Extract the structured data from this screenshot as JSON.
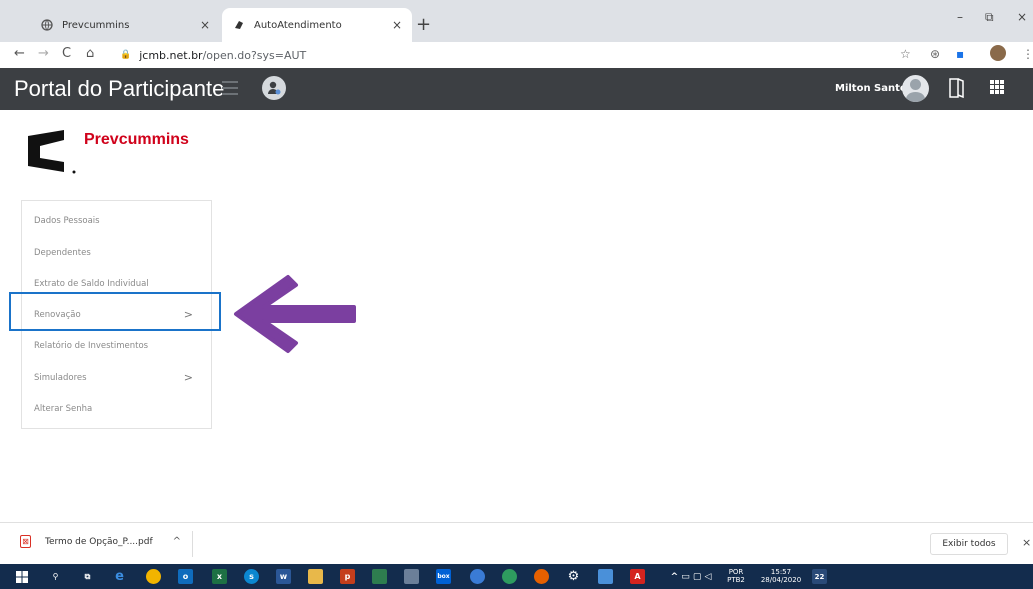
{
  "browser": {
    "tabs": [
      {
        "label": "Prevcummins",
        "close": "×"
      },
      {
        "label": "AutoAtendimento",
        "close": "×"
      }
    ],
    "new_tab": "+",
    "window_controls": {
      "minimize": "–",
      "restore": "⧉",
      "close": "×"
    },
    "nav": {
      "back": "←",
      "forward": "→",
      "reload": "C",
      "home": "⌂"
    },
    "url": {
      "host": "jcmb.net.br",
      "path": "/open.do?sys=AUT"
    }
  },
  "header": {
    "title": "Portal do Participante",
    "user_name": "Milton Santos"
  },
  "logo": {
    "brand": "Prevcummins"
  },
  "menu": {
    "items": [
      {
        "label": "Dados Pessoais",
        "chevron": ""
      },
      {
        "label": "Dependentes",
        "chevron": ""
      },
      {
        "label": "Extrato de Saldo Individual",
        "chevron": ""
      },
      {
        "label": "Renovação",
        "chevron": ">"
      },
      {
        "label": "Relatório de Investimentos",
        "chevron": ""
      },
      {
        "label": "Simuladores",
        "chevron": ">"
      },
      {
        "label": "Alterar Senha",
        "chevron": ""
      }
    ]
  },
  "annotation": {
    "arrow_color": "#7b3fa0",
    "highlight_color": "#1a73c9"
  },
  "downloads": {
    "file_name": "Termo de Opção_P....pdf",
    "chevron": "^",
    "show_all": "Exibir todos",
    "close": "×"
  },
  "taskbar": {
    "lang": "POR",
    "layout": "PTB2",
    "time": "15:57",
    "date": "28/04/2020",
    "notification_count": "22"
  }
}
